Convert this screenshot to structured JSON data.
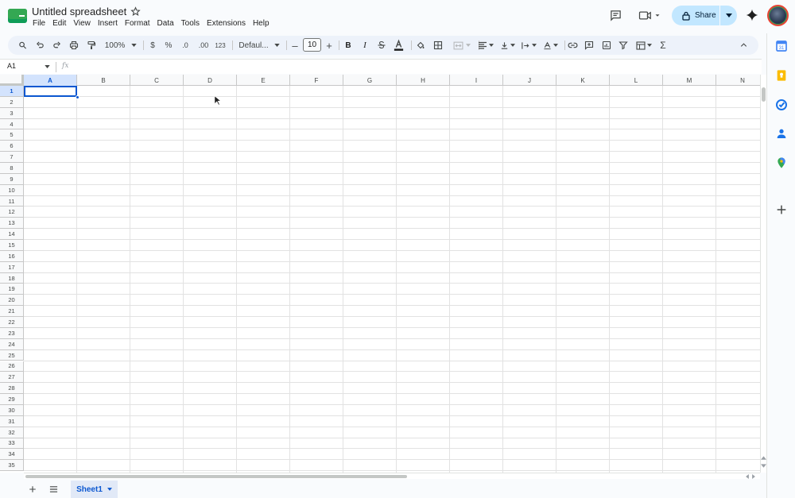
{
  "doc": {
    "title": "Untitled spreadsheet"
  },
  "menu": [
    "File",
    "Edit",
    "View",
    "Insert",
    "Format",
    "Data",
    "Tools",
    "Extensions",
    "Help"
  ],
  "share": {
    "label": "Share"
  },
  "toolbar": {
    "zoom": "100%",
    "currency": "$",
    "percent": "%",
    "dec_decrease": ".0",
    "dec_increase": ".00",
    "number_format": "123",
    "font": "Defaul...",
    "font_size": "10",
    "bold": "B",
    "italic": "I",
    "sum": "Σ"
  },
  "formula_bar": {
    "cell_ref": "A1",
    "fx": "fx"
  },
  "columns": [
    "A",
    "B",
    "C",
    "D",
    "E",
    "F",
    "G",
    "H",
    "I",
    "J",
    "K",
    "L",
    "M",
    "N"
  ],
  "rows": [
    "1",
    "2",
    "3",
    "4",
    "5",
    "6",
    "7",
    "8",
    "9",
    "10",
    "11",
    "12",
    "13",
    "14",
    "15",
    "16",
    "17",
    "18",
    "19",
    "20",
    "21",
    "22",
    "23",
    "24",
    "25",
    "26",
    "27",
    "28",
    "29",
    "30",
    "31",
    "32",
    "33",
    "34",
    "35"
  ],
  "selection": {
    "column": "A",
    "row": "1"
  },
  "sheets": [
    {
      "name": "Sheet1",
      "active": true
    }
  ],
  "colors": {
    "accent": "#0b57d0",
    "share_bg": "#c2e7ff",
    "toolbar_bg": "#edf2fa",
    "logo_green": "#0f9d58"
  }
}
